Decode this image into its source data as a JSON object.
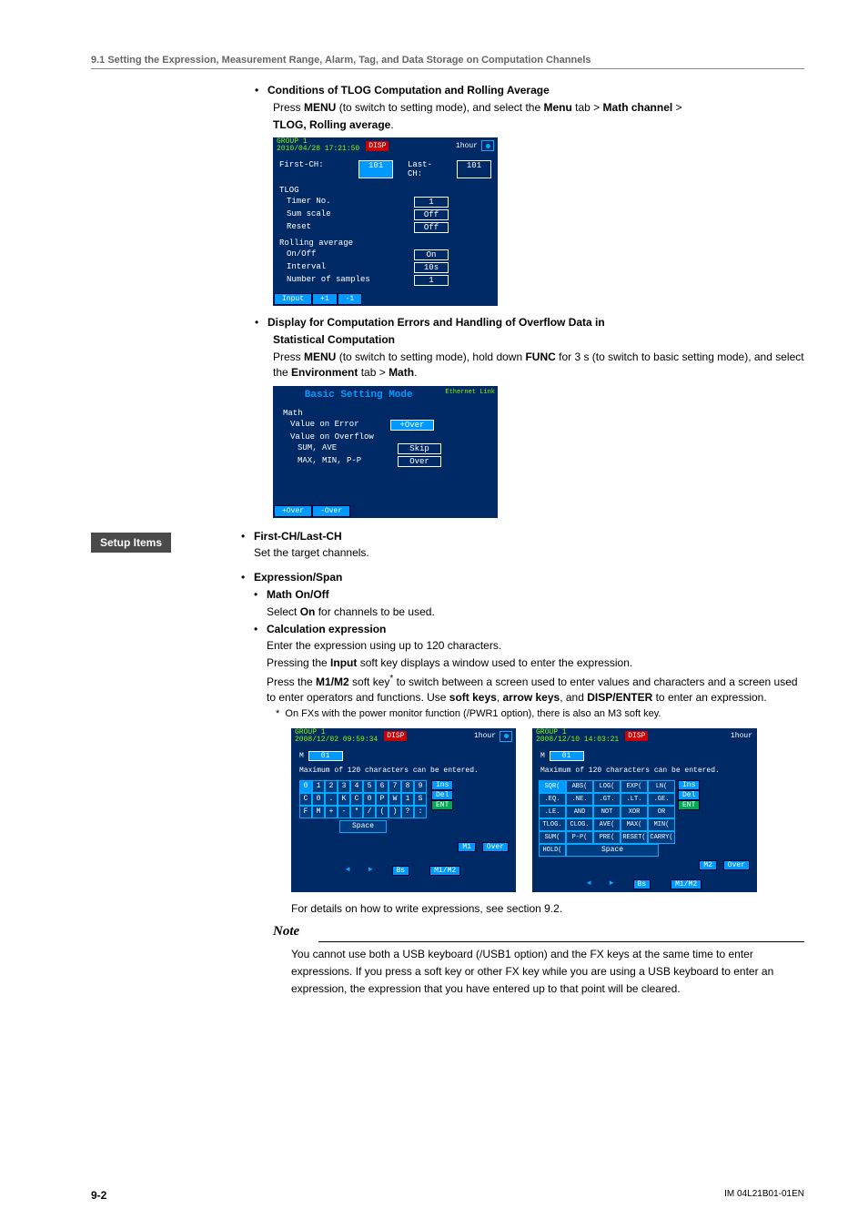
{
  "section_header": "9.1  Setting the Expression, Measurement Range, Alarm, Tag, and Data Storage on Computation Channels",
  "cond": {
    "title": "Conditions of TLOG Computation and Rolling Average",
    "text1a": "Press ",
    "menu": "MENU",
    "text1b": " (to switch to setting mode), and select the ",
    "menuTab": "Menu",
    "text1c": " tab > ",
    "mathCh": "Math channel",
    "text1d": " > ",
    "tlog": "TLOG, Rolling average",
    "text1e": "."
  },
  "shot1": {
    "group": "GROUP 1",
    "ts": "2010/04/28 17:21:50",
    "disp": "DISP",
    "hour": "1hour",
    "firstCH": "First-CH:",
    "firstVal": "101",
    "lastCH": "Last-CH:",
    "lastVal": "101",
    "tlog": "TLOG",
    "timerNo": "Timer No.",
    "timerNoV": "1",
    "sumScale": "Sum scale",
    "sumScaleV": "Off",
    "reset": "Reset",
    "resetV": "Off",
    "rolling": "Rolling average",
    "onoff": "On/Off",
    "onoffV": "On",
    "interval": "Interval",
    "intervalV": "10s",
    "numSamp": "Number of samples",
    "numSampV": "1",
    "f1": "Input",
    "f2": "+1",
    "f3": "-1"
  },
  "disp": {
    "title1": "Display for Computation Errors and Handling of Overflow Data in",
    "title2": "Statistical Computation",
    "t1": "Press ",
    "menu": "MENU",
    "t2": " (to switch to setting mode), hold down ",
    "func": "FUNC",
    "t3": " for 3 s (to switch to basic setting mode), and select the ",
    "env": "Environment",
    "t4": " tab > ",
    "math": "Math",
    "t5": "."
  },
  "shot2": {
    "title": "Basic Setting Mode",
    "corner": "Ethernet Link",
    "math": "Math",
    "line1": "Value on Error",
    "v1": "+Over",
    "line2": "Value on Overflow",
    "line3": "SUM, AVE",
    "v3": "Skip",
    "line4": "MAX, MIN, P-P",
    "v4": "Over",
    "f1": "+Over",
    "f2": "-Over"
  },
  "setup": "Setup Items",
  "firstLast": {
    "title": "First-CH/Last-CH",
    "text": "Set the target channels."
  },
  "exprSpan": {
    "title": "Expression/Span",
    "mathOnOff": "Math On/Off",
    "mathOnOffT1": "Select ",
    "on": "On",
    "mathOnOffT2": " for channels to be used.",
    "calc": "Calculation expression",
    "calcT1": "Enter the expression using up to 120 characters.",
    "calcT2a": "Pressing the ",
    "input": "Input",
    "calcT2b": " soft key displays a window used to enter the expression.",
    "calcT3a": "Press the ",
    "m1m2": "M1/M2",
    "calcT3b": " soft key",
    "calcT3c": " to switch between a screen used to enter values and characters and a screen used to enter operators and functions. Use ",
    "softkeys": "soft keys",
    "calcT3d": ", ",
    "arrow": "arrow keys",
    "calcT3e": ", and ",
    "dispEnter": "DISP/ENTER",
    "calcT3f": " to enter an expression.",
    "note": "On FXs with the power monitor function (/PWR1 option), there is also an M3 soft key."
  },
  "shot3a": {
    "group": "GROUP 1",
    "ts": "2008/12/02 09:59:34",
    "disp": "DISP",
    "hour": "1hour",
    "inp": "01",
    "msg": "Maximum of 120 characters can be entered.",
    "row1": [
      "0",
      "1",
      "2",
      "3",
      "4",
      "5",
      "6",
      "7",
      "8",
      "9"
    ],
    "row2": [
      "C",
      "0",
      ".",
      "K",
      "C",
      "0",
      "P",
      "W",
      "1",
      "S"
    ],
    "row3": [
      "F",
      "M",
      "+",
      "-",
      "*",
      "/",
      "(",
      ")",
      "?",
      ":"
    ],
    "ins": "Ins",
    "del": "Del",
    "ent": "ENT",
    "space": "Space",
    "m1": "M1",
    "over": "Over",
    "bs": "Bs",
    "m1m2": "M1/M2"
  },
  "shot3b": {
    "group": "GROUP 1",
    "ts": "2008/12/10 14:03:21",
    "disp": "DISP",
    "hour": "1hour",
    "inp": "01",
    "msg": "Maximum of 120 characters can be entered.",
    "ops": [
      [
        "SQR(",
        "ABS(",
        "LOG(",
        "EXP(",
        "LN("
      ],
      [
        ".EQ.",
        ".NE.",
        ".GT.",
        ".LT.",
        ".GE."
      ],
      [
        ".LE.",
        "AND",
        "NOT",
        "XOR",
        "OR"
      ],
      [
        "TLOG.",
        "CLOG.",
        "AVE(",
        "MAX(",
        "MIN("
      ],
      [
        "SUM(",
        "P-P(",
        "PRE(",
        "RESET(",
        "CARRY("
      ],
      [
        "HOLD("
      ]
    ],
    "ins": "Ins",
    "del": "Del",
    "ent": "ENT",
    "space": "Space",
    "m2": "M2",
    "over": "Over",
    "bs": "Bs",
    "m1m2": "M1/M2"
  },
  "details": "For details on how to write expressions, see section 9.2.",
  "noteTitle": "Note",
  "noteBody": "You cannot use both a USB keyboard (/USB1 option) and the FX keys at the same time to enter expressions. If you press a soft key or other FX key while you are using a USB keyboard to enter an expression, the expression that you have entered up to that point will be cleared.",
  "footer": {
    "page": "9-2",
    "doc": "IM 04L21B01-01EN"
  }
}
